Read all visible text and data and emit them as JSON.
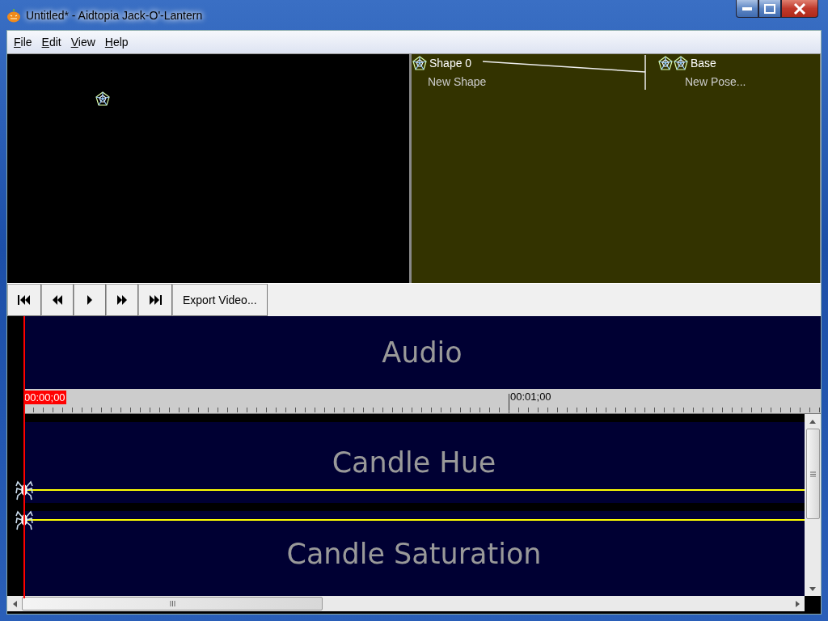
{
  "window": {
    "title": "Untitled* - Aidtopia Jack-O'-Lantern"
  },
  "menu": [
    {
      "label": "File"
    },
    {
      "label": "Edit"
    },
    {
      "label": "View"
    },
    {
      "label": "Help"
    }
  ],
  "shape_graph": {
    "shapes": [
      {
        "name": "Shape 0"
      }
    ],
    "new_shape": "New Shape",
    "poses": [
      {
        "name": "Base"
      }
    ],
    "new_pose": "New Pose..."
  },
  "transport": {
    "buttons": [
      {
        "kind": "first"
      },
      {
        "kind": "prev"
      },
      {
        "kind": "play"
      },
      {
        "kind": "next"
      },
      {
        "kind": "last"
      }
    ],
    "export": "Export Video..."
  },
  "timeline": {
    "audio": "Audio",
    "playhead_time": "00:00;00",
    "ruler_labels": [
      "00:01;00"
    ],
    "tracks": [
      {
        "name": "Candle Hue"
      },
      {
        "name": "Candle Saturation"
      }
    ]
  }
}
